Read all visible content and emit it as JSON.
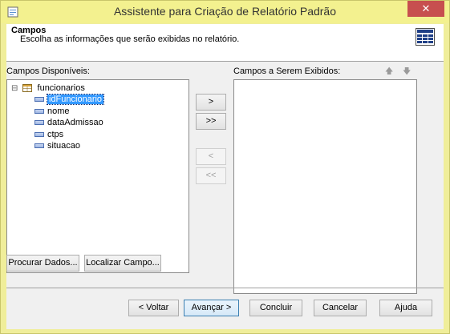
{
  "window": {
    "title": "Assistente para Criação de Relatório Padrão",
    "close_glyph": "✕"
  },
  "header": {
    "title": "Campos",
    "subtitle": "Escolha as informações que serão exibidas no relatório.",
    "icon": "table-icon"
  },
  "available": {
    "label": "Campos Disponíveis:",
    "tree": {
      "expander": "⊟",
      "table": "funcionarios",
      "fields": [
        "idFuncionario",
        "nome",
        "dataAdmissao",
        "ctps",
        "situacao"
      ],
      "selected_index": 0
    }
  },
  "shown": {
    "label": "Campos a Serem Exibidos:",
    "up_glyph": "🡅",
    "down_glyph": "🡇",
    "items": []
  },
  "move_buttons": {
    "add": ">",
    "add_all": ">>",
    "remove": "<",
    "remove_all": "<<"
  },
  "left_buttons": {
    "browse": "Procurar Dados...",
    "locate": "Localizar Campo..."
  },
  "footer": {
    "back": "< Voltar",
    "next": "Avançar >",
    "finish": "Concluir",
    "cancel": "Cancelar",
    "help": "Ajuda"
  }
}
